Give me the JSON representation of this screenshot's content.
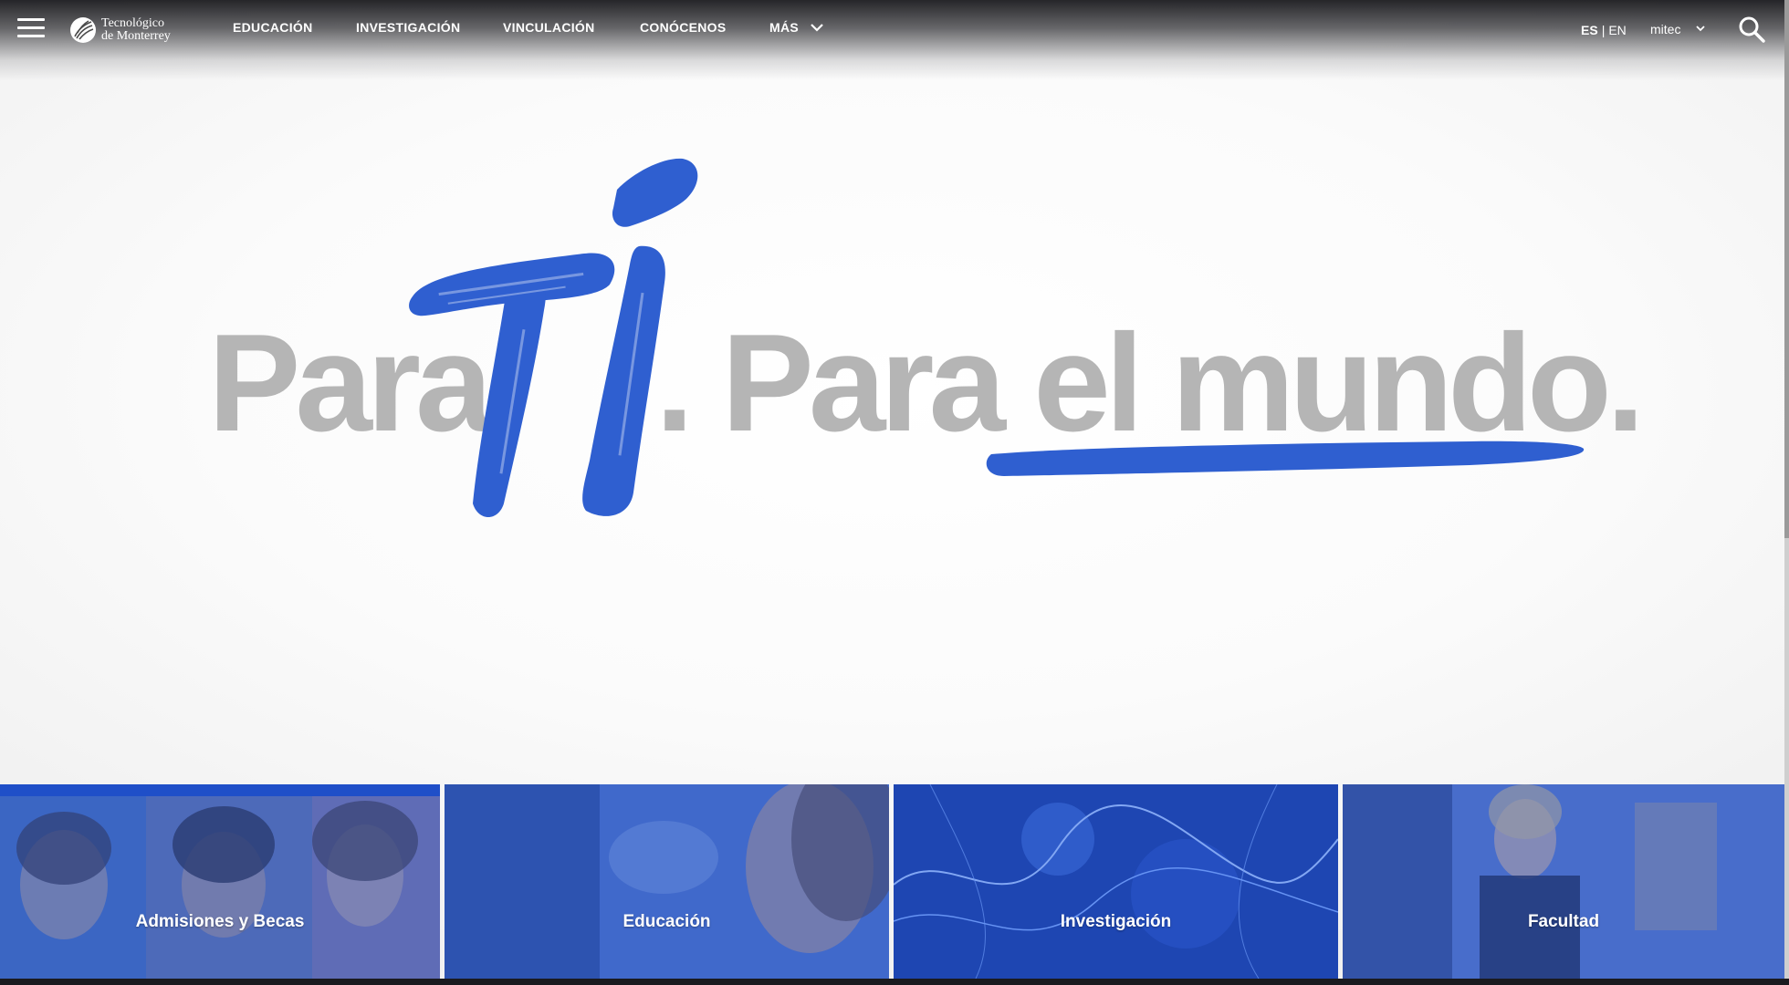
{
  "header": {
    "logo": {
      "line1": "Tecnológico",
      "line2": "de Monterrey",
      "icon": "tec-logo-icon"
    },
    "menu_icon": "hamburger-menu-icon",
    "nav": [
      {
        "label": "EDUCACIÓN"
      },
      {
        "label": "INVESTIGACIÓN"
      },
      {
        "label": "VINCULACIÓN"
      },
      {
        "label": "CONÓCENOS"
      },
      {
        "label": "MÁS",
        "icon": "chevron-down-icon"
      }
    ],
    "language": {
      "active": "ES",
      "separator": "|",
      "other": "EN"
    },
    "account": {
      "label": "mitec",
      "icon": "chevron-down-icon"
    },
    "search_icon": "search-icon"
  },
  "hero": {
    "brand_word_1": "Para",
    "brand_highlight": "Tí",
    "brand_rest": ". Para el mundo.",
    "accent_color": "#2f5fd0",
    "text_color": "#b5b5b5"
  },
  "cards": [
    {
      "label": "Admisiones y Becas",
      "active": true
    },
    {
      "label": "Educación"
    },
    {
      "label": "Investigación"
    },
    {
      "label": "Facultad"
    }
  ],
  "colors": {
    "brand_blue": "#1f4fc8",
    "card_overlay": "#2a5bd1"
  }
}
